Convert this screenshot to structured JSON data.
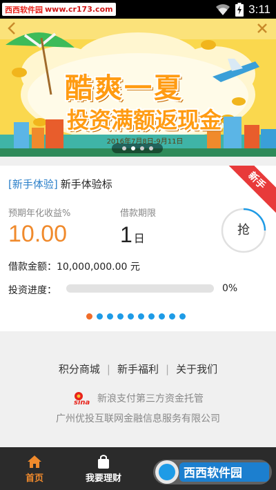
{
  "status_bar": {
    "watermark_site": "西西软件园",
    "watermark_url": "www.cr173.com",
    "time": "3:11",
    "icons": [
      "wifi-icon",
      "battery-charging-icon"
    ]
  },
  "banner": {
    "title_line1": "酷爽一夏",
    "title_line2": "投资满额返现金",
    "date_range": "2016年7月8日-9月11日",
    "page_count": 4,
    "active_page": 1
  },
  "product": {
    "tag": "[新手体验]",
    "name": "新手体验标",
    "ribbon": "新手",
    "rate_label": "预期年化收益%",
    "rate_value": "10.00",
    "term_label": "借款期限",
    "term_value": "1",
    "term_unit": "日",
    "grab_label": "抢",
    "amount_label": "借款金额：",
    "amount_value": "10,000,000.00 元",
    "progress_label": "投资进度：",
    "progress_percent": "0%",
    "progress_fraction": 0,
    "pager_count": 10,
    "pager_active": 0
  },
  "footer": {
    "links": [
      "积分商城",
      "新手福利",
      "关于我们"
    ],
    "sina_logo_text": "sina",
    "custody_text": "新浪支付第三方资金托管",
    "company_text": "广州优投互联网金融信息服务有限公司"
  },
  "nav": {
    "items": [
      {
        "label": "首页",
        "icon": "home-icon",
        "active": true
      },
      {
        "label": "我要理财",
        "icon": "shopping-bag-icon",
        "active": false
      }
    ],
    "watermark": "西西软件园"
  },
  "colors": {
    "accent_orange": "#f08a2c",
    "tag_blue": "#2a7fc9",
    "ribbon_red": "#e83a3a",
    "pager_blue": "#1e9be6",
    "nav_bg": "#2b2b2b"
  }
}
